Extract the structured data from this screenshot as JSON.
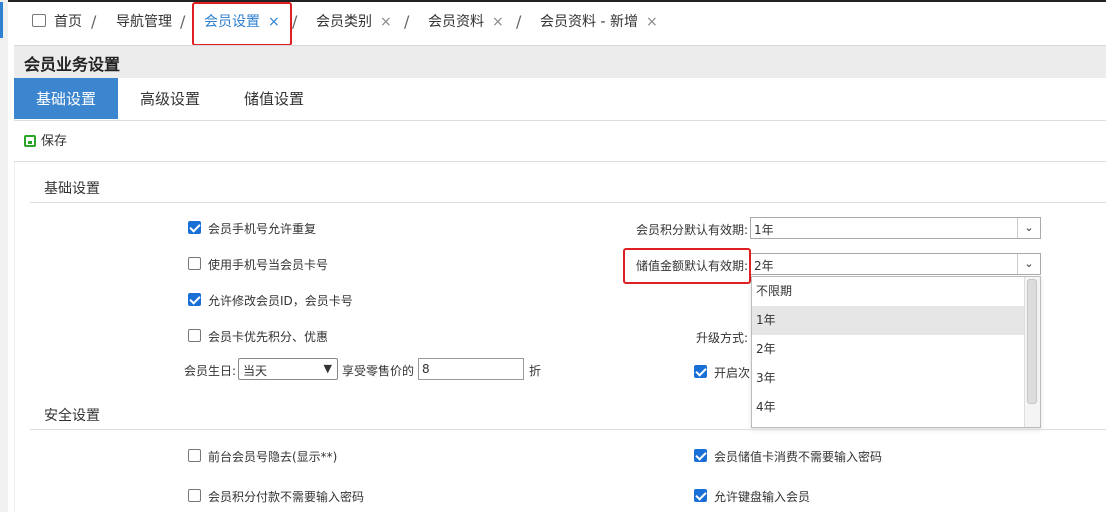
{
  "tabs": {
    "home": "首页",
    "nav": "导航管理",
    "member_settings": "会员设置",
    "member_category": "会员类别",
    "member_profile": "会员资料",
    "member_profile_new": "会员资料 - 新增",
    "close_glyph": "×",
    "separator": "/"
  },
  "panel": {
    "title": "会员业务设置"
  },
  "subtabs": {
    "basic": "基础设置",
    "advanced": "高级设置",
    "stored_value": "储值设置"
  },
  "toolbar": {
    "save": "保存"
  },
  "sections": {
    "basic": {
      "title": "基础设置",
      "allow_dup_phone": {
        "label": "会员手机号允许重复",
        "checked": true
      },
      "phone_as_card": {
        "label": "使用手机号当会员卡号",
        "checked": false
      },
      "allow_edit_id": {
        "label": "允许修改会员ID，会员卡号",
        "checked": true
      },
      "card_priority": {
        "label": "会员卡优先积分、优惠",
        "checked": false
      },
      "birthday": {
        "label": "会员生日:",
        "select_value": "当天",
        "discount_label": "享受零售价的",
        "discount_value": "8",
        "unit": "折"
      },
      "points_validity": {
        "label": "会员积分默认有效期:",
        "value": "1年"
      },
      "stored_validity": {
        "label": "储值金额默认有效期:",
        "value": "2年"
      },
      "upgrade_mode": {
        "label": "升级方式:"
      },
      "enable_times": {
        "label": "开启次",
        "checked": true
      },
      "dropdown_options": [
        "不限期",
        "1年",
        "2年",
        "3年",
        "4年"
      ],
      "dropdown_highlight": "1年"
    },
    "security": {
      "title": "安全设置",
      "hide_card": {
        "label": "前台会员号隐去(显示**)",
        "checked": false
      },
      "points_no_pwd": {
        "label": "会员积分付款不需要输入密码",
        "checked": false
      },
      "stored_no_pwd": {
        "label": "会员储值卡消费不需要输入密码",
        "checked": true
      },
      "keyboard_input": {
        "label": "允许键盘输入会员",
        "checked": true
      }
    }
  },
  "colors": {
    "accent": "#3c86cf",
    "highlight_box": "#e02020",
    "checkbox": "#1a6fd6",
    "save_icon": "#2aa52a"
  }
}
